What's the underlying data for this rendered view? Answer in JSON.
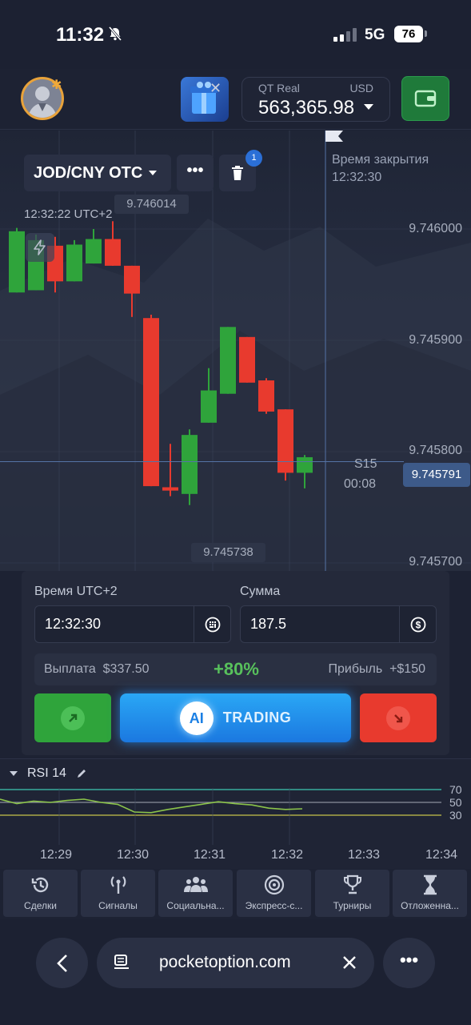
{
  "status_bar": {
    "time": "11:32",
    "network": "5G",
    "battery": "76"
  },
  "header": {
    "account_type": "QT Real",
    "currency": "USD",
    "balance": "563,365.98"
  },
  "chart": {
    "pair": "JOD/CNY OTC",
    "more_label": "•••",
    "trash_badge": "1",
    "chart_time": "12:32:22 UTC+2",
    "price_tag_top": "9.746014",
    "price_tag_low": "9.745738",
    "close_label": "Время закрытия",
    "close_time": "12:32:30",
    "price_axis": [
      "9.746000",
      "9.745900",
      "9.745800",
      "9.745700"
    ],
    "timeframe": "S15",
    "countdown": "00:08",
    "current_price": "9.745791"
  },
  "trade": {
    "time_label": "Время UTC+2",
    "time_value": "12:32:30",
    "amount_label": "Сумма",
    "amount_value": "187.5",
    "payout_label": "Выплата",
    "payout_value": "$337.50",
    "payout_percent": "+80%",
    "profit_label": "Прибыль",
    "profit_value": "+$150",
    "ai_badge": "AI",
    "ai_text": "TRADING"
  },
  "rsi": {
    "label": "RSI 14",
    "levels": [
      "70",
      "50",
      "30"
    ]
  },
  "time_axis": [
    "12:29",
    "12:30",
    "12:31",
    "12:32",
    "12:33",
    "12:34"
  ],
  "nav": [
    {
      "label": "Сделки",
      "icon": "history-icon"
    },
    {
      "label": "Сигналы",
      "icon": "signal-icon"
    },
    {
      "label": "Социальна...",
      "icon": "social-icon"
    },
    {
      "label": "Экспресс-с...",
      "icon": "target-icon"
    },
    {
      "label": "Турниры",
      "icon": "trophy-icon"
    },
    {
      "label": "Отложенна...",
      "icon": "hourglass-icon"
    }
  ],
  "browser": {
    "url": "pocketoption.com",
    "more": "•••"
  },
  "colors": {
    "up": "#2fa43b",
    "down": "#e83a2e",
    "accent": "#1b78e0",
    "payout": "#58c15c"
  },
  "chart_data": {
    "type": "candlestick",
    "ylim": [
      9.74568,
      9.74602
    ],
    "candles": [
      {
        "open": 9.745943,
        "close": 9.745998,
        "high": 9.746001,
        "low": 9.745943
      },
      {
        "open": 9.745945,
        "close": 9.74599,
        "high": 9.745995,
        "low": 9.745945
      },
      {
        "open": 9.745985,
        "close": 9.745953,
        "high": 9.745993,
        "low": 9.745943
      },
      {
        "open": 9.745953,
        "close": 9.745986,
        "high": 9.74599,
        "low": 9.745953
      },
      {
        "open": 9.745969,
        "close": 9.745991,
        "high": 9.746,
        "low": 9.745969
      },
      {
        "open": 9.745991,
        "close": 9.745967,
        "high": 9.746007,
        "low": 9.745967
      },
      {
        "open": 9.745967,
        "close": 9.745942,
        "high": 9.745967,
        "low": 9.745921
      },
      {
        "open": 9.74592,
        "close": 9.745769,
        "high": 9.745923,
        "low": 9.745769
      },
      {
        "open": 9.745768,
        "close": 9.745765,
        "high": 9.745807,
        "low": 9.74576
      },
      {
        "open": 9.745762,
        "close": 9.745815,
        "high": 9.74582,
        "low": 9.745752
      },
      {
        "open": 9.745826,
        "close": 9.745855,
        "high": 9.745875,
        "low": 9.745826
      },
      {
        "open": 9.745852,
        "close": 9.745912,
        "high": 9.745912,
        "low": 9.745852
      },
      {
        "open": 9.745903,
        "close": 9.745862,
        "high": 9.745903,
        "low": 9.745862
      },
      {
        "open": 9.745864,
        "close": 9.745836,
        "high": 9.745866,
        "low": 9.745834
      },
      {
        "open": 9.745838,
        "close": 9.745781,
        "high": 9.745838,
        "low": 9.745774
      },
      {
        "open": 9.745781,
        "close": 9.745795,
        "high": 9.745797,
        "low": 9.745767
      }
    ]
  },
  "rsi_data": {
    "levels": [
      70,
      50,
      30
    ],
    "values": [
      55,
      48,
      52,
      50,
      53,
      55,
      50,
      47,
      35,
      34,
      39,
      43,
      47,
      51,
      48,
      46,
      41,
      39,
      40
    ]
  }
}
